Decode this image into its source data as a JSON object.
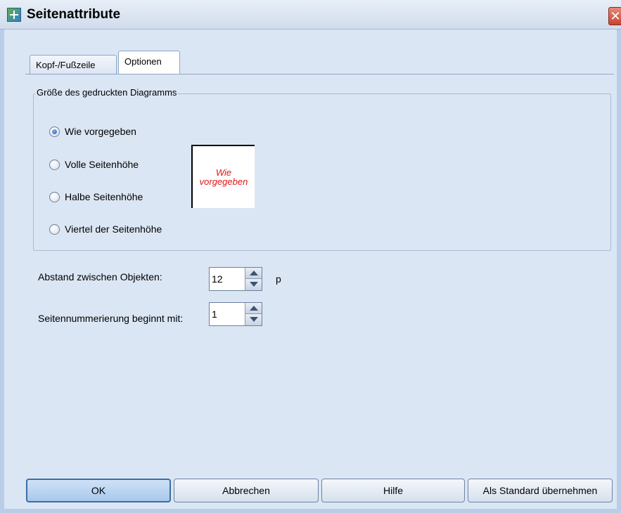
{
  "window": {
    "title": "Seitenattribute",
    "close_glyph": "✕"
  },
  "tabs": [
    {
      "label": "Kopf-/Fußzeile",
      "active": false
    },
    {
      "label": "Optionen",
      "active": true
    }
  ],
  "chart_size_group": {
    "legend": "Größe des gedruckten Diagramms",
    "options": [
      {
        "label": "Wie vorgegeben",
        "checked": true
      },
      {
        "label": "Volle Seitenhöhe",
        "checked": false
      },
      {
        "label": "Halbe Seitenhöhe",
        "checked": false
      },
      {
        "label": "Viertel der Seitenhöhe",
        "checked": false
      }
    ],
    "preview_text": [
      "Wie",
      "vorgegeben"
    ],
    "preview_text_color": "#e01515"
  },
  "spacing": {
    "label": "Abstand zwischen Objekten:",
    "value": "12",
    "unit": "p"
  },
  "page_numbering": {
    "label": "Seitennummerierung beginnt mit:",
    "value": "1"
  },
  "buttons": {
    "ok": "OK",
    "cancel": "Abbrechen",
    "help": "Hilfe",
    "set_default": "Als Standard übernehmen"
  },
  "colors": {
    "dialog_bg": "#dbe6f4",
    "accent": "#3a6ea5"
  }
}
